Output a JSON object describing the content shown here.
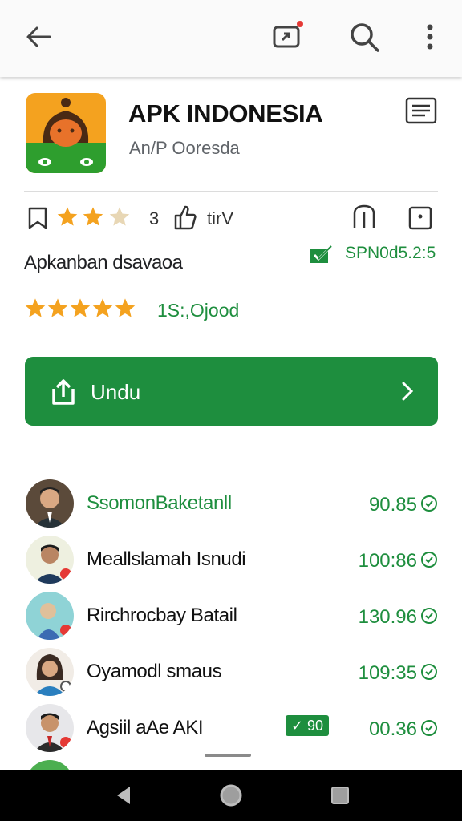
{
  "topbar": {
    "back_icon": "arrow-left-icon",
    "share_icon": "share-screen-icon",
    "search_icon": "search-icon",
    "more_icon": "more-vertical-icon"
  },
  "app": {
    "title": "APK INDONESIA",
    "subtitle": "An/P Ooresda",
    "menu_icon": "list-icon"
  },
  "rating_row": {
    "rating_count": "3",
    "label": "tirV",
    "stars_filled": 2,
    "stars_total": 3
  },
  "info_row": {
    "text": "Apkanban dsavaoa",
    "version_text": "SPN0d5.2:5"
  },
  "rating_row2": {
    "stars_filled": 5,
    "text": "1S:,Ojood"
  },
  "install_button": {
    "label": "Undu"
  },
  "users": [
    {
      "name": "SsomonBaketanll",
      "score": "90.85",
      "name_color": "#1e8e3e",
      "badge": ""
    },
    {
      "name": "Meallslamah Isnudi",
      "score": "100:86",
      "name_color": "#111111",
      "badge": ""
    },
    {
      "name": "Rirchrocbay Batail",
      "score": "130.96",
      "name_color": "#111111",
      "badge": ""
    },
    {
      "name": "Oyamodl smaus",
      "score": "109:35",
      "name_color": "#111111",
      "badge": ""
    },
    {
      "name": "Agsiil aAe AKI",
      "score": "00.36",
      "name_color": "#111111",
      "badge": "✓ 90"
    }
  ],
  "colors": {
    "accent": "#1e8e3e",
    "star": "#f4a21f"
  }
}
